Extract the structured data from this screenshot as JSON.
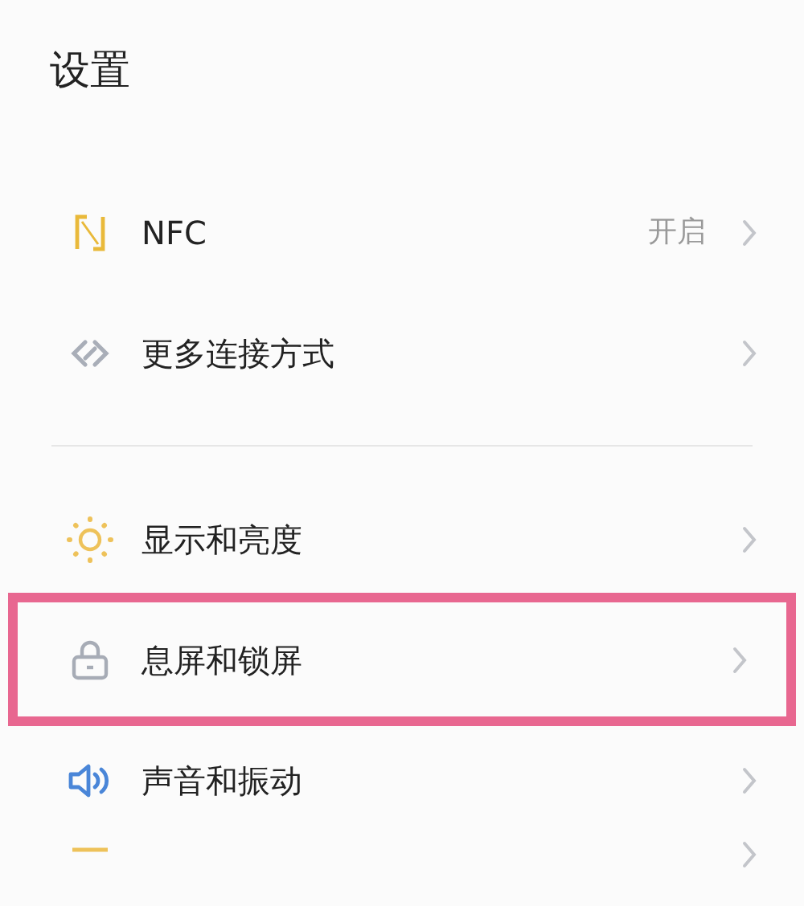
{
  "title": "设置",
  "groups": [
    {
      "items": [
        {
          "kind": "nfc",
          "label": "NFC",
          "value": "开启",
          "highlighted": false
        },
        {
          "kind": "link",
          "label": "更多连接方式",
          "highlighted": false
        }
      ]
    },
    {
      "items": [
        {
          "kind": "sun",
          "label": "显示和亮度",
          "highlighted": false
        },
        {
          "kind": "lock",
          "label": "息屏和锁屏",
          "highlighted": true
        },
        {
          "kind": "speaker",
          "label": "声音和振动",
          "highlighted": false
        },
        {
          "kind": "notification",
          "highlighted": false
        }
      ]
    }
  ]
}
